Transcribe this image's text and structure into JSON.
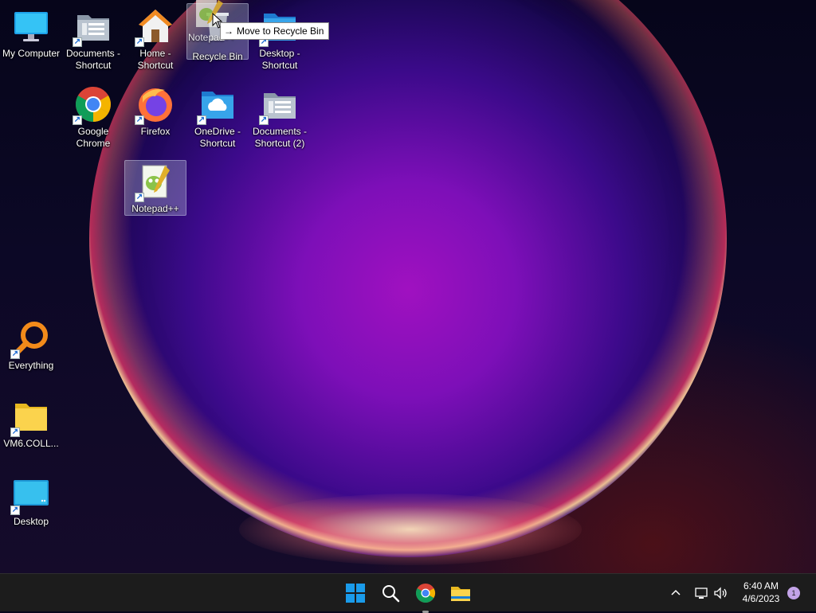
{
  "desktop": {
    "icons": [
      {
        "label": "My Computer"
      },
      {
        "label": "Documents - Shortcut"
      },
      {
        "label": "Home - Shortcut"
      },
      {
        "label": "Recycle Bin"
      },
      {
        "label": "Desktop - Shortcut"
      },
      {
        "label": "Google Chrome"
      },
      {
        "label": "Firefox"
      },
      {
        "label": "OneDrive - Shortcut"
      },
      {
        "label": "Documents - Shortcut (2)"
      },
      {
        "label": "Notepad++"
      },
      {
        "label": "Everything"
      },
      {
        "label": "VM6.COLL..."
      },
      {
        "label": "Desktop"
      }
    ],
    "drag_label": "Notepad++",
    "tooltip": "Move to Recycle Bin"
  },
  "taskbar": {
    "apps": [
      {
        "icon": "windows-start-icon"
      },
      {
        "icon": "search-icon"
      },
      {
        "icon": "chrome-icon"
      },
      {
        "icon": "file-explorer-icon"
      }
    ],
    "clock": {
      "time": "6:40 AM",
      "date": "4/6/2023"
    },
    "notification_count": "1"
  },
  "colors": {
    "taskbar_bg": "#1c1c1c",
    "accent": "#0078d4",
    "selection": "#c8d2e6"
  }
}
